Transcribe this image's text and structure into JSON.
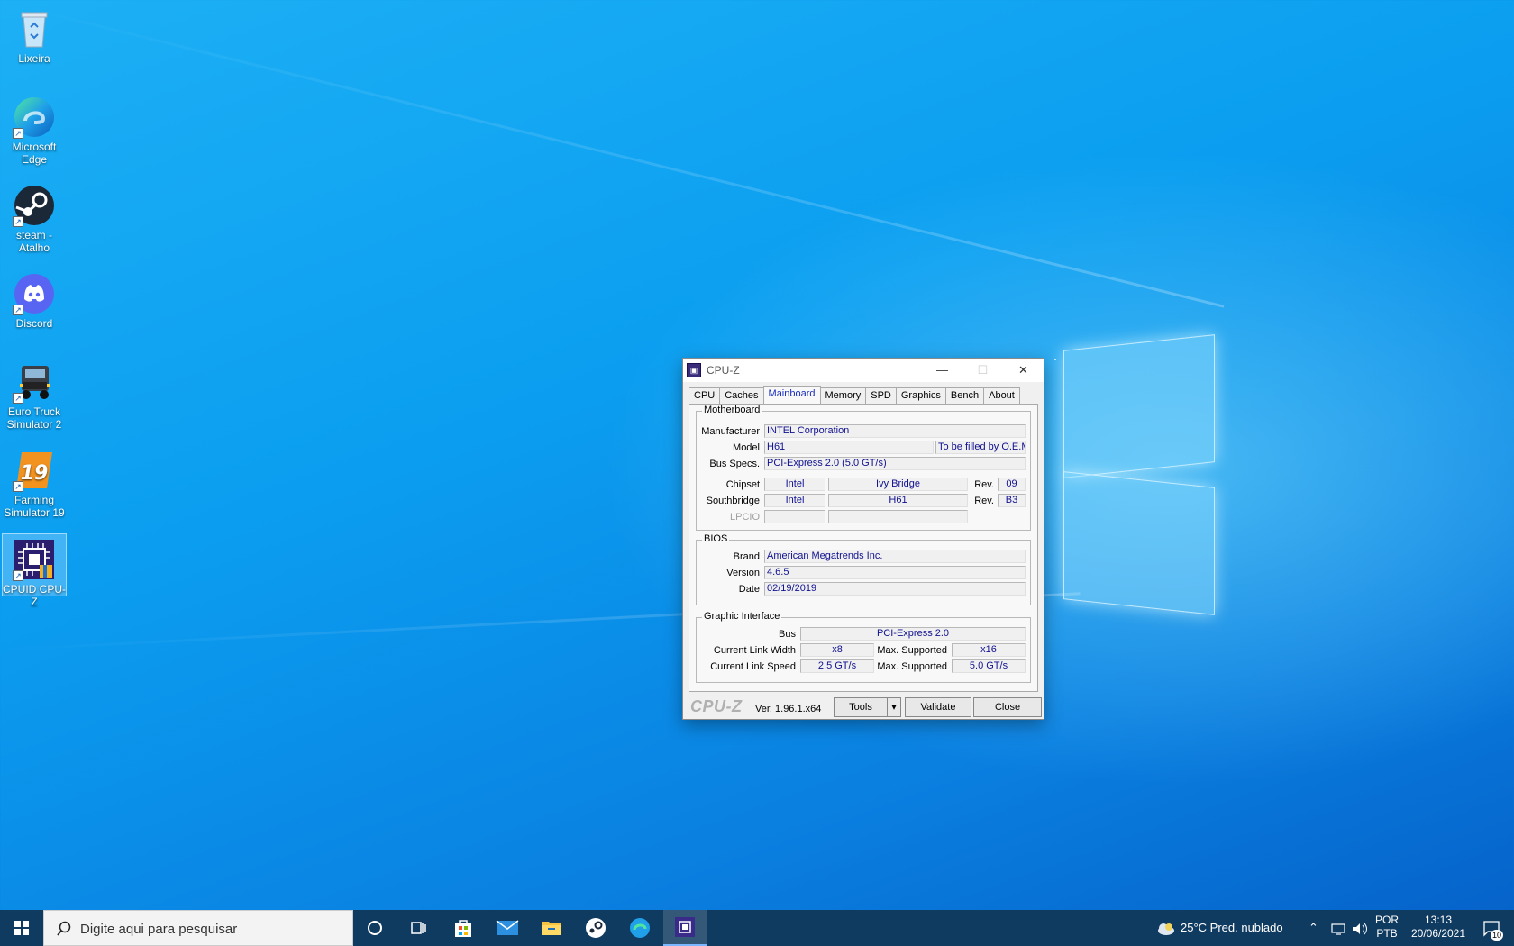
{
  "desktop": {
    "icons": [
      {
        "label": "Lixeira",
        "icon": "recycle-bin-icon"
      },
      {
        "label": "Microsoft Edge",
        "icon": "edge-icon"
      },
      {
        "label": "steam - Atalho",
        "icon": "steam-icon"
      },
      {
        "label": "Discord",
        "icon": "discord-icon"
      },
      {
        "label": "Euro Truck Simulator 2",
        "icon": "truck-icon"
      },
      {
        "label": "Farming Simulator 19",
        "icon": "farming-19-icon"
      },
      {
        "label": "CPUID CPU-Z",
        "icon": "cpuz-icon"
      }
    ]
  },
  "cpuz": {
    "title": "CPU-Z",
    "tabs": [
      "CPU",
      "Caches",
      "Mainboard",
      "Memory",
      "SPD",
      "Graphics",
      "Bench",
      "About"
    ],
    "active_tab": "Mainboard",
    "motherboard": {
      "legend": "Motherboard",
      "manufacturer_label": "Manufacturer",
      "manufacturer": "INTEL Corporation",
      "model_label": "Model",
      "model": "H61",
      "model_extra": "To be filled by O.E.M.",
      "bus_label": "Bus Specs.",
      "bus": "PCI-Express 2.0 (5.0 GT/s)",
      "chipset_label": "Chipset",
      "chipset_vendor": "Intel",
      "chipset_name": "Ivy Bridge",
      "chipset_rev_label": "Rev.",
      "chipset_rev": "09",
      "southbridge_label": "Southbridge",
      "southbridge_vendor": "Intel",
      "southbridge_name": "H61",
      "southbridge_rev_label": "Rev.",
      "southbridge_rev": "B3",
      "lpcio_label": "LPCIO"
    },
    "bios": {
      "legend": "BIOS",
      "brand_label": "Brand",
      "brand": "American Megatrends Inc.",
      "version_label": "Version",
      "version": "4.6.5",
      "date_label": "Date",
      "date": "02/19/2019"
    },
    "graphic": {
      "legend": "Graphic Interface",
      "bus_label": "Bus",
      "bus": "PCI-Express 2.0",
      "width_label": "Current Link Width",
      "width": "x8",
      "width_max_label": "Max. Supported",
      "width_max": "x16",
      "speed_label": "Current Link Speed",
      "speed": "2.5 GT/s",
      "speed_max_label": "Max. Supported",
      "speed_max": "5.0 GT/s"
    },
    "footer": {
      "logo": "CPU-Z",
      "version": "Ver. 1.96.1.x64",
      "tools": "Tools",
      "validate": "Validate",
      "close": "Close"
    }
  },
  "taskbar": {
    "search_placeholder": "Digite aqui para pesquisar",
    "weather": "25°C  Pred. nublado",
    "lang_top": "POR",
    "lang_bottom": "PTB",
    "time": "13:13",
    "date": "20/06/2021",
    "notifications": "10"
  }
}
